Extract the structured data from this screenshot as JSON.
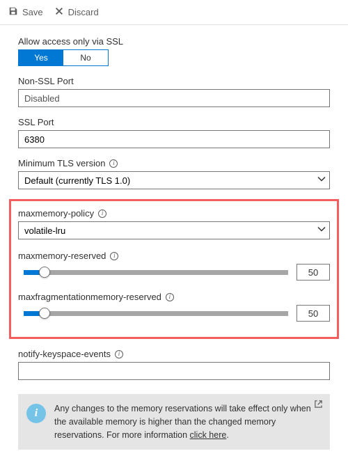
{
  "toolbar": {
    "save_label": "Save",
    "discard_label": "Discard"
  },
  "ssl_access": {
    "label": "Allow access only via SSL",
    "yes": "Yes",
    "no": "No",
    "selected": "Yes"
  },
  "non_ssl_port": {
    "label": "Non-SSL Port",
    "value": "Disabled"
  },
  "ssl_port": {
    "label": "SSL Port",
    "value": "6380"
  },
  "min_tls": {
    "label": "Minimum TLS version",
    "value": "Default (currently TLS 1.0)"
  },
  "maxmemory_policy": {
    "label": "maxmemory-policy",
    "value": "volatile-lru"
  },
  "maxmemory_reserved": {
    "label": "maxmemory-reserved",
    "value": "50",
    "fill_pct": 8
  },
  "maxfrag_reserved": {
    "label": "maxfragmentationmemory-reserved",
    "value": "50",
    "fill_pct": 8
  },
  "notify_keyspace": {
    "label": "notify-keyspace-events",
    "value": ""
  },
  "notice": {
    "text": "Any changes to the memory reservations will take effect only when the available memory is higher than the changed memory reservations. For more information ",
    "link": "click here",
    "suffix": "."
  }
}
